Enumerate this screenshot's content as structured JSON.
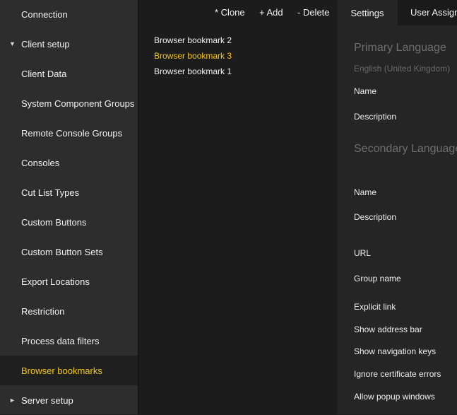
{
  "sidebar": {
    "items": [
      {
        "label": "Connection"
      },
      {
        "label": "Client setup",
        "caret": "▼"
      },
      {
        "label": "Client Data"
      },
      {
        "label": "System Component Groups"
      },
      {
        "label": "Remote Console Groups"
      },
      {
        "label": "Consoles"
      },
      {
        "label": "Cut List Types"
      },
      {
        "label": "Custom Buttons"
      },
      {
        "label": "Custom Button Sets"
      },
      {
        "label": "Export Locations"
      },
      {
        "label": "Restriction"
      },
      {
        "label": "Process data filters"
      },
      {
        "label": "Browser bookmarks",
        "active": true
      },
      {
        "label": "Server setup",
        "caret": "►"
      }
    ]
  },
  "toolbar": {
    "clone_label": "* Clone",
    "add_label": "+ Add",
    "delete_label": "- Delete"
  },
  "list": {
    "items": [
      {
        "label": "Browser bookmark 2"
      },
      {
        "label": "Browser bookmark 3",
        "selected": true
      },
      {
        "label": "Browser bookmark 1"
      }
    ]
  },
  "tabs": {
    "settings_label": "Settings",
    "user_assign_label": "User Assignments"
  },
  "details": {
    "primary_heading": "Primary Language",
    "primary_language_value": "English (United Kingdom)",
    "primary_name_label": "Name",
    "primary_description_label": "Description",
    "secondary_heading": "Secondary Language",
    "secondary_name_label": "Name",
    "secondary_description_label": "Description",
    "url_label": "URL",
    "group_name_label": "Group name",
    "explicit_link_label": "Explicit link",
    "show_address_bar_label": "Show address bar",
    "show_navigation_keys_label": "Show navigation keys",
    "ignore_cert_errors_label": "Ignore certificate errors",
    "allow_popup_label": "Allow popup windows"
  },
  "colors": {
    "accent": "#f5c518",
    "sidebar_bg": "#2d2d2d",
    "panel_bg": "#252525",
    "page_bg": "#1c1c1c"
  }
}
